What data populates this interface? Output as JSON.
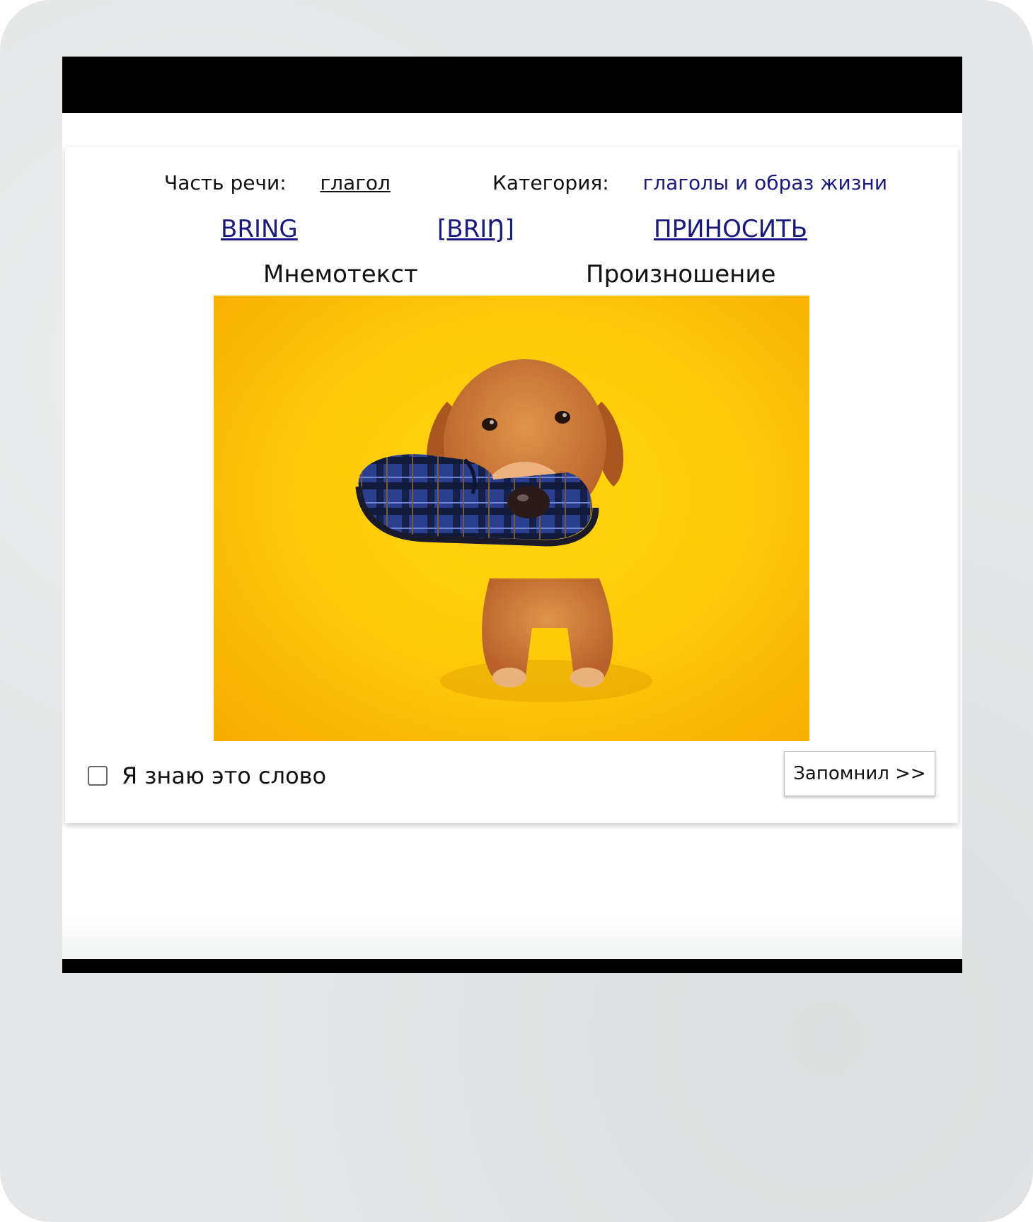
{
  "card": {
    "part_of_speech_label": "Часть речи:",
    "part_of_speech_value": "глагол",
    "category_label": "Категория:",
    "category_value": "глаголы и образ жизни",
    "word": "BRING",
    "transcription": "[BRIŊ]",
    "translation": "ПРИНОСИТЬ",
    "mnemotext_label": "Мнемотекст",
    "pronunciation_label": "Произношение",
    "know_word_label": "Я знаю это слово",
    "know_word_checked": false,
    "remembered_button": "Запомнил >>"
  },
  "picture": {
    "subject": "dog-holding-slipper-icon",
    "background_color": "#ffcc0a"
  },
  "colors": {
    "link": "#1a1a7a",
    "frame": "#e4e6e7",
    "bars": "#000000"
  }
}
